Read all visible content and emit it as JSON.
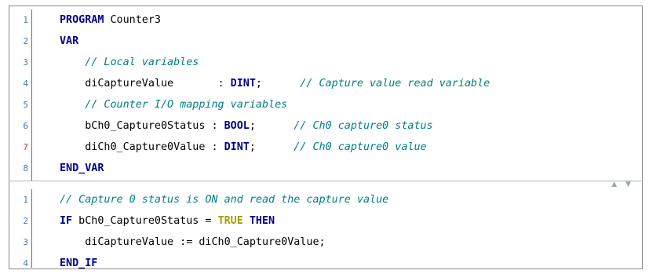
{
  "declaration_pane": {
    "lines": [
      {
        "num": "1",
        "parts": [
          {
            "t": "PROGRAM",
            "c": "kw"
          },
          {
            "t": " Counter3",
            "c": ""
          }
        ]
      },
      {
        "num": "2",
        "parts": [
          {
            "t": "VAR",
            "c": "kw"
          }
        ]
      },
      {
        "num": "3",
        "parts": [
          {
            "t": "    // Local variables",
            "c": "cm"
          }
        ]
      },
      {
        "num": "4",
        "parts": [
          {
            "t": "    diCaptureValue       : ",
            "c": ""
          },
          {
            "t": "DINT",
            "c": "kw"
          },
          {
            "t": ";      ",
            "c": ""
          },
          {
            "t": "// Capture value read variable",
            "c": "cm"
          }
        ]
      },
      {
        "num": "5",
        "parts": [
          {
            "t": "    // Counter I/O mapping variables",
            "c": "cm"
          }
        ]
      },
      {
        "num": "6",
        "parts": [
          {
            "t": "    bCh0_Capture0Status : ",
            "c": ""
          },
          {
            "t": "BOOL",
            "c": "kw"
          },
          {
            "t": ";      ",
            "c": ""
          },
          {
            "t": "// Ch0 capture0 status",
            "c": "cm"
          }
        ]
      },
      {
        "num": "7",
        "parts": [
          {
            "t": "    diCh0_Capture0Value : ",
            "c": ""
          },
          {
            "t": "DINT",
            "c": "kw"
          },
          {
            "t": ";      ",
            "c": ""
          },
          {
            "t": "// Ch0 capture0 value",
            "c": "cm"
          }
        ]
      },
      {
        "num": "8",
        "parts": [
          {
            "t": "END_VAR",
            "c": "kw"
          }
        ]
      }
    ]
  },
  "implementation_pane": {
    "lines": [
      {
        "num": "1",
        "parts": [
          {
            "t": "// Capture 0 status is ON and read the capture value",
            "c": "cm"
          }
        ]
      },
      {
        "num": "2",
        "parts": [
          {
            "t": "IF",
            "c": "kw"
          },
          {
            "t": " bCh0_Capture0Status = ",
            "c": ""
          },
          {
            "t": "TRUE",
            "c": "lit"
          },
          {
            "t": " ",
            "c": ""
          },
          {
            "t": "THEN",
            "c": "kw"
          }
        ]
      },
      {
        "num": "3",
        "parts": [
          {
            "t": "    diCaptureValue := diCh0_Capture0Value;",
            "c": ""
          }
        ]
      },
      {
        "num": "4",
        "parts": [
          {
            "t": "END_IF",
            "c": "kw"
          }
        ]
      }
    ]
  },
  "splitter": {
    "arrows": "▲ ▼"
  },
  "colors": {
    "keyword": "#00008b",
    "comment": "#008080",
    "literal": "#a0a000",
    "line_number": "#4a73b8",
    "marked_line_number": "#c0392b"
  },
  "marked_line": {
    "pane": "declaration_pane",
    "num": "7"
  }
}
